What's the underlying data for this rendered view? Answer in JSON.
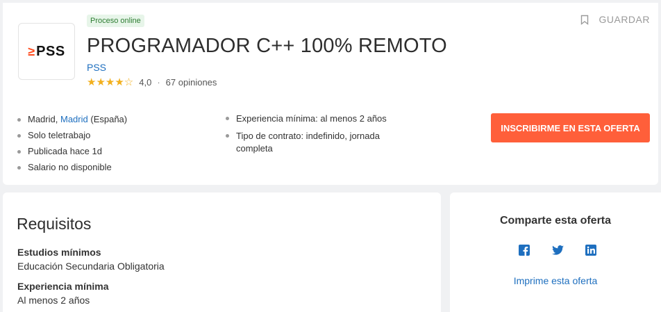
{
  "header": {
    "badge": "Proceso online",
    "title": "PROGRAMADOR C++ 100% REMOTO",
    "company": "PSS",
    "logo_text": "PSS",
    "rating": "4,0",
    "opinions": "67 opiniones",
    "save_label": "GUARDAR"
  },
  "details": {
    "location_city": "Madrid,",
    "location_link": "Madrid",
    "location_country": "(España)",
    "remote": "Solo teletrabajo",
    "published": "Publicada hace 1d",
    "salary": "Salario no disponible",
    "experience": "Experiencia mínima: al menos 2 años",
    "contract": "Tipo de contrato: indefinido, jornada completa"
  },
  "apply_label": "INSCRIBIRME EN ESTA OFERTA",
  "requirements": {
    "heading": "Requisitos",
    "studies_label": "Estudios mínimos",
    "studies_value": "Educación Secundaria Obligatoria",
    "experience_label": "Experiencia mínima",
    "experience_value": "Al menos 2 años"
  },
  "share": {
    "heading": "Comparte esta oferta",
    "icons": [
      "facebook-icon",
      "twitter-icon",
      "linkedin-icon"
    ],
    "print_label": "Imprime esta oferta"
  },
  "colors": {
    "accent": "#ff5f3a",
    "link": "#1e6fbf",
    "badge_bg": "#e7f5e9",
    "badge_text": "#2e7d32",
    "star": "#f2b01e",
    "social": "#1e6fbf"
  }
}
